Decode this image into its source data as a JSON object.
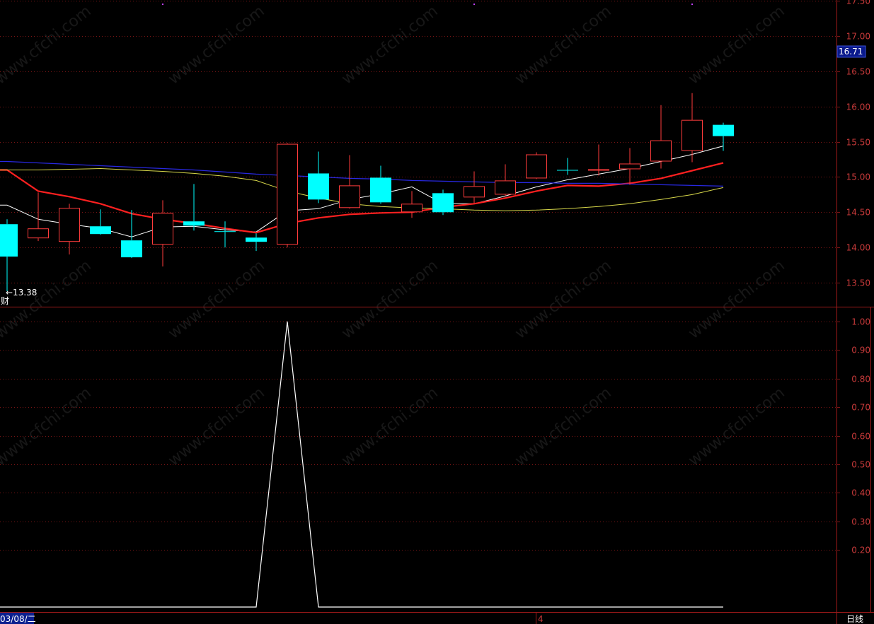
{
  "watermark": "www.cfchi.com",
  "price_axis": {
    "ticks": [
      "17.50",
      "17.00",
      "16.50",
      "16.00",
      "15.50",
      "15.00",
      "14.50",
      "14.00",
      "13.50"
    ],
    "current_price": "16.71"
  },
  "indicator_axis": {
    "ticks": [
      "1.00",
      "0.90",
      "0.80",
      "0.70",
      "0.60",
      "0.50",
      "0.40",
      "0.30",
      "0.20"
    ]
  },
  "low_annotation": "←13.38",
  "side_label": "财",
  "bottom_bar": {
    "date_label": "03/08/二",
    "mid_label": "4",
    "period_label": "日线"
  },
  "colors": {
    "background": "#000000",
    "up": "#ff3c3c",
    "down": "#00ffff",
    "ma_white": "#ffffff",
    "ma_red": "#ff2020",
    "ma_yellow": "#d8d84a",
    "ma_blue": "#2828e0",
    "grid": "#7a1515",
    "axis_text": "#c83a3a"
  },
  "chart_data": [
    {
      "type": "candlestick",
      "ylim": [
        13.2,
        17.55
      ],
      "candles": [
        {
          "open": 14.33,
          "high": 14.4,
          "low": 13.38,
          "close": 13.87
        },
        {
          "open": 14.13,
          "high": 14.78,
          "low": 14.09,
          "close": 14.27
        },
        {
          "open": 14.08,
          "high": 14.62,
          "low": 13.9,
          "close": 14.56
        },
        {
          "open": 14.3,
          "high": 14.54,
          "low": 14.18,
          "close": 14.19
        },
        {
          "open": 14.1,
          "high": 14.53,
          "low": 13.85,
          "close": 13.86
        },
        {
          "open": 14.04,
          "high": 14.67,
          "low": 13.73,
          "close": 14.49
        },
        {
          "open": 14.37,
          "high": 14.9,
          "low": 14.24,
          "close": 14.31
        },
        {
          "open": 14.23,
          "high": 14.37,
          "low": 14.0,
          "close": 14.22
        },
        {
          "open": 14.14,
          "high": 14.2,
          "low": 13.95,
          "close": 14.08
        },
        {
          "open": 14.04,
          "high": 15.48,
          "low": 14.0,
          "close": 15.47
        },
        {
          "open": 15.05,
          "high": 15.36,
          "low": 14.63,
          "close": 14.68
        },
        {
          "open": 14.56,
          "high": 15.31,
          "low": 14.55,
          "close": 14.88
        },
        {
          "open": 14.99,
          "high": 15.16,
          "low": 14.62,
          "close": 14.64
        },
        {
          "open": 14.5,
          "high": 14.8,
          "low": 14.42,
          "close": 14.62
        },
        {
          "open": 14.77,
          "high": 14.82,
          "low": 14.46,
          "close": 14.5
        },
        {
          "open": 14.71,
          "high": 15.08,
          "low": 14.63,
          "close": 14.87
        },
        {
          "open": 14.75,
          "high": 15.18,
          "low": 14.73,
          "close": 14.95
        },
        {
          "open": 14.98,
          "high": 15.35,
          "low": 14.97,
          "close": 15.32
        },
        {
          "open": 15.1,
          "high": 15.27,
          "low": 15.03,
          "close": 15.1
        },
        {
          "open": 15.1,
          "high": 15.46,
          "low": 15.02,
          "close": 15.11
        },
        {
          "open": 15.11,
          "high": 15.41,
          "low": 14.89,
          "close": 15.19
        },
        {
          "open": 15.22,
          "high": 16.02,
          "low": 15.12,
          "close": 15.52
        },
        {
          "open": 15.37,
          "high": 16.19,
          "low": 15.21,
          "close": 15.81
        },
        {
          "open": 15.74,
          "high": 15.77,
          "low": 15.37,
          "close": 15.58
        }
      ],
      "moving_averages": [
        {
          "color": "white",
          "values": [
            14.6,
            14.4,
            14.33,
            14.27,
            14.15,
            14.29,
            14.3,
            14.25,
            14.22,
            14.52,
            14.55,
            14.68,
            14.76,
            14.86,
            14.62,
            14.62,
            14.73,
            14.86,
            14.96,
            15.04,
            15.12,
            15.22,
            15.32,
            15.44
          ]
        },
        {
          "color": "red",
          "values": [
            15.1,
            14.8,
            14.72,
            14.62,
            14.48,
            14.4,
            14.34,
            14.27,
            14.21,
            14.34,
            14.42,
            14.47,
            14.49,
            14.5,
            14.57,
            14.62,
            14.7,
            14.8,
            14.88,
            14.87,
            14.91,
            14.98,
            15.09,
            15.2
          ]
        },
        {
          "color": "yellow",
          "values": [
            15.1,
            15.1,
            15.11,
            15.12,
            15.1,
            15.08,
            15.05,
            15.01,
            14.95,
            14.8,
            14.7,
            14.62,
            14.58,
            14.56,
            14.55,
            14.53,
            14.52,
            14.53,
            14.55,
            14.58,
            14.62,
            14.68,
            14.75,
            14.85
          ]
        },
        {
          "color": "blue",
          "values": [
            15.22,
            15.2,
            15.18,
            15.16,
            15.14,
            15.12,
            15.1,
            15.07,
            15.04,
            15.02,
            15.0,
            14.98,
            14.97,
            14.95,
            14.94,
            14.93,
            14.92,
            14.92,
            14.91,
            14.91,
            14.9,
            14.89,
            14.88,
            14.87
          ]
        }
      ]
    },
    {
      "type": "line",
      "ylim": [
        0,
        1.0
      ],
      "values": [
        0,
        0,
        0,
        0,
        0,
        0,
        0,
        0,
        0,
        1.0,
        0,
        0,
        0,
        0,
        0,
        0,
        0,
        0,
        0,
        0,
        0,
        0,
        0,
        0
      ]
    }
  ]
}
